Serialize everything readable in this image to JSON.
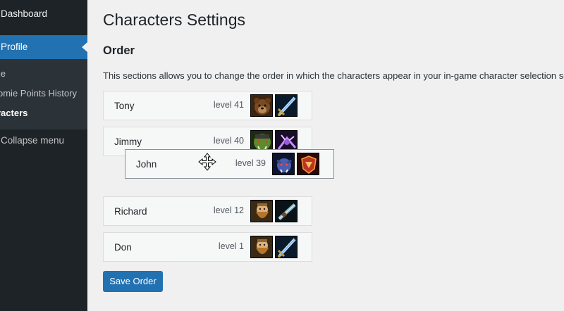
{
  "sidebar": {
    "dashboard": "Dashboard",
    "profile": "Profile",
    "submenu": [
      "ile",
      "omie Points History",
      "racters"
    ],
    "collapse": "Collapse menu"
  },
  "page": {
    "title": "Characters Settings",
    "section_title": "Order",
    "description": "This sections allows you to change the order in which the characters appear in your in-game character selection sc"
  },
  "characters": [
    {
      "name": "Tony",
      "level": "level 41",
      "avatars": [
        "bear-portrait-icon",
        "sword-icon"
      ]
    },
    {
      "name": "Jimmy",
      "level": "level 40",
      "avatars": [
        "orc-portrait-icon",
        "purple-spell-icon"
      ]
    },
    {
      "name": "Richard",
      "level": "level 12",
      "avatars": [
        "dwarf-portrait-icon",
        "rifle-icon"
      ]
    },
    {
      "name": "Don",
      "level": "level 1",
      "avatars": [
        "dwarf-portrait-icon",
        "sword-icon"
      ]
    }
  ],
  "dragging": {
    "name": "John",
    "level": "level 39",
    "avatars": [
      "troll-portrait-icon",
      "red-shield-icon"
    ]
  },
  "actions": {
    "save": "Save Order"
  },
  "colors": {
    "accent": "#2271b1",
    "sidebar_bg": "#1d2327",
    "page_bg": "#f0f0f1"
  }
}
